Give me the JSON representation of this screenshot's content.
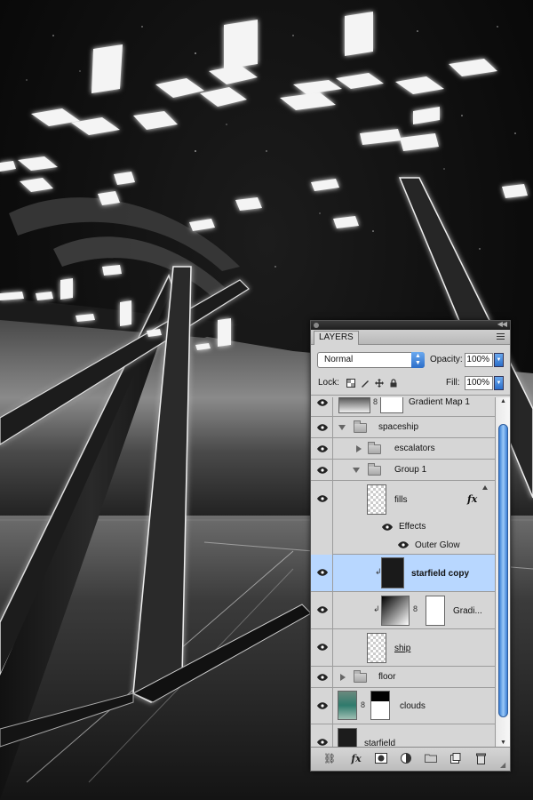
{
  "panel": {
    "tab_label": "LAYERS",
    "blend_mode": "Normal",
    "opacity_label": "Opacity:",
    "opacity_value": "100%",
    "lock_label": "Lock:",
    "fill_label": "Fill:",
    "fill_value": "100%"
  },
  "layers": {
    "gradient_map": "Gradient Map 1",
    "spaceship": "spaceship",
    "escalators": "escalators",
    "group1": "Group 1",
    "fills": "fills",
    "effects": "Effects",
    "outer_glow": "Outer Glow",
    "starfield_copy": "starfield copy",
    "gradi": "Gradi...",
    "ship": "ship",
    "floor": "floor",
    "clouds": "clouds",
    "starfield": "starfield"
  },
  "icons": {
    "visibility": "eye-icon",
    "group": "folder-icon",
    "effects": "fx-icon",
    "link": "chain-link-icon",
    "clip": "clipping-arrow-icon"
  },
  "colors": {
    "panel_bg": "#d6d6d6",
    "selection": "#b8d7ff",
    "scroll_accent": "#3a7fd6"
  }
}
